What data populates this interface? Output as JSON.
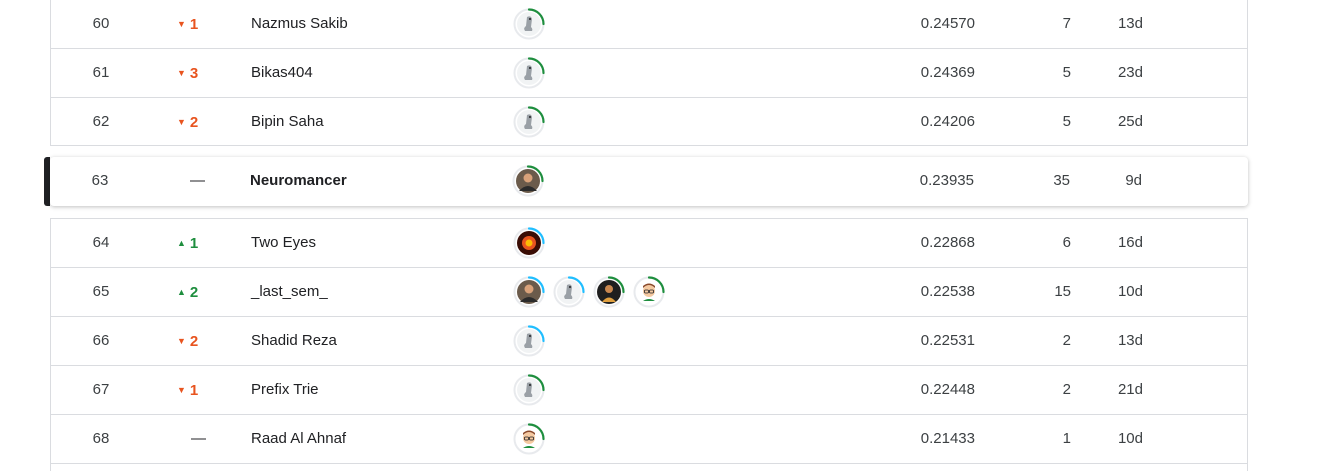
{
  "leaderboard": {
    "rows": [
      {
        "rank": "60",
        "change": "1",
        "dir": "down",
        "name": "Nazmus Sakib",
        "score": "0.24570",
        "entries": "7",
        "last": "13d",
        "avatars": [
          {
            "icon": "goose-avatar-icon",
            "ring": "#1e8e3e"
          }
        ]
      },
      {
        "rank": "61",
        "change": "3",
        "dir": "down",
        "name": "Bikas404",
        "score": "0.24369",
        "entries": "5",
        "last": "23d",
        "avatars": [
          {
            "icon": "goose-avatar-icon",
            "ring": "#1e8e3e"
          }
        ]
      },
      {
        "rank": "62",
        "change": "2",
        "dir": "down",
        "name": "Bipin Saha",
        "score": "0.24206",
        "entries": "5",
        "last": "25d",
        "avatars": [
          {
            "icon": "goose-avatar-icon",
            "ring": "#1e8e3e"
          }
        ]
      },
      {
        "rank": "63",
        "change": "—",
        "dir": "same",
        "name": "Neuromancer",
        "score": "0.23935",
        "entries": "35",
        "last": "9d",
        "avatars": [
          {
            "icon": "photo-avatar-icon",
            "ring": "#1e8e3e"
          }
        ]
      },
      {
        "rank": "64",
        "change": "1",
        "dir": "up",
        "name": "Two Eyes",
        "score": "0.22868",
        "entries": "6",
        "last": "16d",
        "avatars": [
          {
            "icon": "fire-avatar-icon",
            "ring": "#20beff"
          }
        ]
      },
      {
        "rank": "65",
        "change": "2",
        "dir": "up",
        "name": "_last_sem_",
        "score": "0.22538",
        "entries": "15",
        "last": "10d",
        "avatars": [
          {
            "icon": "photo-avatar-icon",
            "ring": "#20beff"
          },
          {
            "icon": "goose-avatar-icon",
            "ring": "#20beff"
          },
          {
            "icon": "dark-photo-avatar-icon",
            "ring": "#1e8e3e"
          },
          {
            "icon": "cartoon-avatar-icon",
            "ring": "#1e8e3e"
          }
        ]
      },
      {
        "rank": "66",
        "change": "2",
        "dir": "down",
        "name": "Shadid Reza",
        "score": "0.22531",
        "entries": "2",
        "last": "13d",
        "avatars": [
          {
            "icon": "goose-avatar-icon",
            "ring": "#20beff"
          }
        ]
      },
      {
        "rank": "67",
        "change": "1",
        "dir": "down",
        "name": "Prefix Trie",
        "score": "0.22448",
        "entries": "2",
        "last": "21d",
        "avatars": [
          {
            "icon": "goose-avatar-icon",
            "ring": "#1e8e3e"
          }
        ]
      },
      {
        "rank": "68",
        "change": "—",
        "dir": "same",
        "name": "Raad Al Ahnaf",
        "score": "0.21433",
        "entries": "1",
        "last": "10d",
        "avatars": [
          {
            "icon": "cartoon-avatar-icon",
            "ring": "#1e8e3e"
          }
        ]
      }
    ],
    "user_row_index": 3
  },
  "colors": {
    "down": "#e8541f",
    "up": "#1e8e3e",
    "ring_green": "#1e8e3e",
    "ring_blue": "#20beff",
    "user_bar": "#202124"
  }
}
